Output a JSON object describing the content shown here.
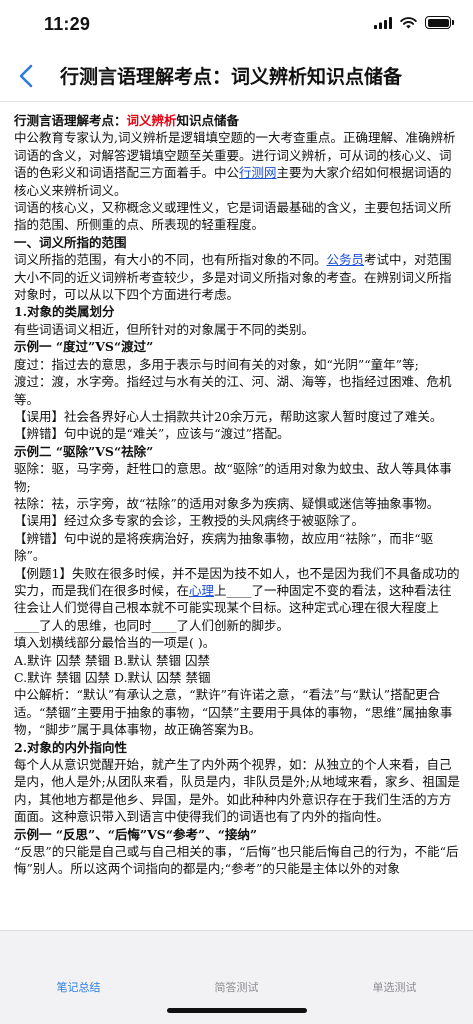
{
  "status": {
    "time": "11:29"
  },
  "nav": {
    "title": "行测言语理解考点：词义辨析知识点储备"
  },
  "article": {
    "title_pre": "行测言语理解考点：",
    "title_hl": "词义辨析",
    "title_post": "知识点储备",
    "p1_a": "中公教育专家认为,词义辨析是逻辑填空题的一大考查重点。正确理解、准确辨析词语的含义，对解答逻辑填空题至关重要。进行词义辨析，可从词的核心义、词语的色彩义和词语搭配三方面着手。中公",
    "p1_link": "行测网",
    "p1_b": "主要为大家介绍如何根据词语的核心义来辨析词义。",
    "p2": "词语的核心义，又称概念义或理性义，它是词语最基础的含义，主要包括词义所指的范围、所侧重的点、所表现的轻重程度。",
    "h1": "一、词义所指的范围",
    "p3_a": "词义所指的范围，有大小的不同，也有所指对象的不同。",
    "p3_link": "公务员",
    "p3_b": "考试中，对范围大小不同的近义词辨析考查较少，多是对词义所指对象的考查。在辨别词义所指对象时，可以从以下四个方面进行考虑。",
    "h2": "1.对象的类属划分",
    "p4": "有些词语词义相近，但所针对的对象属于不同的类别。",
    "ex1": "示例一 “度过”VS“渡过”",
    "ex1_l1": "度过：指过去的意思，多用于表示与时间有关的对象，如“光阴”“童年”等;",
    "ex1_l2": "渡过：渡，水字旁。指经过与水有关的江、河、湖、海等，也指经过困难、危机等。",
    "ex1_l3": "【误用】社会各界好心人士捐款共计20余万元，帮助这家人暂时度过了难关。",
    "ex1_l4": "【辨错】句中说的是“难关”，应该与“渡过”搭配。",
    "ex2": "示例二 “驱除”VS“祛除”",
    "ex2_l1": "驱除：驱，马字旁，赶牲口的意思。故“驱除”的适用对象为蚊虫、敌人等具体事物;",
    "ex2_l2": "祛除：祛，示字旁，故“祛除”的适用对象多为疾病、疑惧或迷信等抽象事物。",
    "ex2_l3": "【误用】经过众多专家的会诊，王教授的头风病终于被驱除了。",
    "ex2_l4": "【辨错】句中说的是将疾病治好，疾病为抽象事物，故应用“祛除”，而非“驱除”。",
    "q_a": "【例题1】失败在很多时候，并不是因为技不如人，也不是因为我们不具备成功的实力，而是我们在很多时候，在",
    "q_link": "心理",
    "q_b": "上____了一种固定不变的看法，这种看法往往会让人们觉得自己根本就不可能实现某个目标。这种定式心理在很大程度上____了人的思维，也同时____了人们创新的脚步。",
    "q_ask": "填入划横线部分最恰当的一项是( )。",
    "q_opt1": "A.默许 囚禁 禁锢 B.默认 禁锢 囚禁",
    "q_opt2": "C.默许 禁锢 囚禁 D.默认 囚禁 禁锢",
    "analysis": "中公解析：“默认”有承认之意，“默许”有许诺之意，“看法”与“默认”搭配更合适。“禁锢”主要用于抽象的事物，“囚禁”主要用于具体的事物，“思维”属抽象事物，“脚步”属于具体事物，故正确答案为B。",
    "h3": "2.对象的内外指向性",
    "p5": "每个人从意识觉醒开始，就产生了内外两个视界，如：从独立的个人来看，自己是内，他人是外;从团队来看，队员是内，非队员是外;从地域来看，家乡、祖国是内，其他地方都是他乡、异国，是外。如此种种内外意识存在于我们生活的方方面面。这种意识带入到语言中使得我们的词语也有了内外的指向性。",
    "ex3": "示例一 “反思”、“后悔”VS“参考”、“接纳”",
    "p6": "“反思”的只能是自己或与自己相关的事，“后悔”也只能后悔自己的行为，不能“后悔”别人。所以这两个词指向的都是内;“参考”的只能是主体以外的对象"
  },
  "tabs": [
    "笔记总结",
    "简答测试",
    "单选测试"
  ],
  "colors": {
    "accent": "#2a7de1",
    "highlight": "#e60012",
    "link": "#1a4fd6"
  }
}
